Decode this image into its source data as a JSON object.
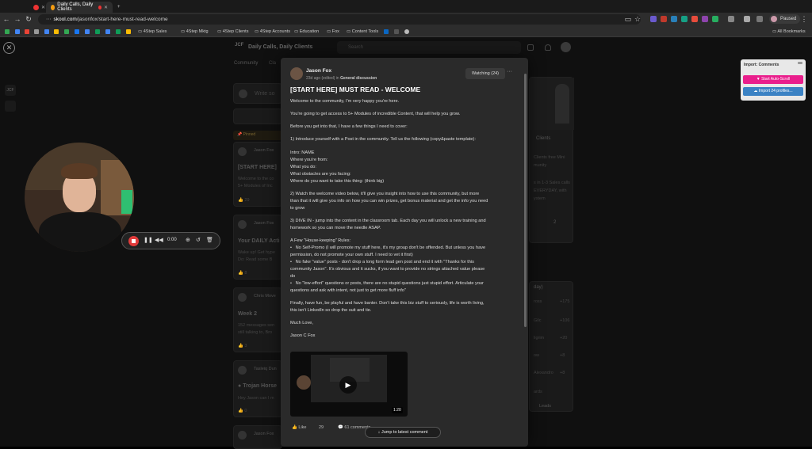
{
  "browser": {
    "tabs": [
      {
        "label": ""
      },
      {
        "label": "Daily Calls, Daily Clients"
      }
    ],
    "url_host": "skool.com",
    "url_path": "/jasonfox/start-here-must-read-welcome",
    "profile_label": "Paused",
    "all_bookmarks": "All Bookmarks",
    "bookmarks": [
      "4Step Sales",
      "4Step Mktg",
      "4Step Clients",
      "4Step Accounts",
      "Education",
      "Fox",
      "Content Tools"
    ]
  },
  "community": {
    "logo": "JCF",
    "name": "Daily Calls, Daily Clients",
    "search_placeholder": "Search",
    "nav_community": "Community",
    "nav_classroom": "Cla",
    "write_placeholder": "Write so",
    "pinned": "Pinned",
    "feed": [
      {
        "author": "Jason Fox",
        "title": "[START HERE]",
        "excerpt1": "Welcome to the co",
        "excerpt2": "5+ Modules of Inc",
        "likes": "29"
      },
      {
        "author": "Jason Fox",
        "title": "Your DAILY Acti",
        "excerpt1": "Wake up! Get hype",
        "excerpt2": "Do: Read some B",
        "likes": "8"
      },
      {
        "author": "Chris Move",
        "title": "Week 2",
        "excerpt1": "152 messages sen",
        "excerpt2": "still talking to, Bro",
        "likes": "3"
      },
      {
        "author": "Tasleiq Dun",
        "title": "Trojan Horse",
        "excerpt1": "Hey Jason can I m",
        "excerpt2": "",
        "likes": "0"
      },
      {
        "author": "Jason Fox",
        "title": "",
        "excerpt1": "",
        "excerpt2": "",
        "likes": ""
      }
    ],
    "sidebar_title": "Clients",
    "sidebar_lines": [
      "Clients free Mini",
      "munity",
      "s in 1-3 Sales calls",
      "EVERYDAY, with",
      "ystem"
    ],
    "leaderboard_title": "day)",
    "leaderboard": [
      {
        "name": "ross",
        "pts": "+175"
      },
      {
        "name": "Gilc",
        "pts": "+106"
      },
      {
        "name": "ligrim",
        "pts": "+20"
      },
      {
        "name": "ow",
        "pts": "+8"
      },
      {
        "name": "Alexandro",
        "pts": "+8"
      }
    ],
    "leaderboard_footer": "ards",
    "leaderboard_link": "Leads"
  },
  "post": {
    "author": "Jason Fox",
    "meta": "23d ago (edited) in",
    "category": "General discussion",
    "watching": "Watching (24)",
    "more": "···",
    "title": "[START HERE] MUST READ - WELCOME",
    "lines": [
      "Welcome to the community, I'm very happy you're here.",
      "You're going to get access to 5+ Modules of incredible Content, that will help you grow.",
      "Before you get into that, I have a few things I need to cover:",
      "1) Introduce yourself with a Post in the community. Tell us the following (copy&paste template):",
      "Intro: NAME",
      "Where you're from:",
      "What you do:",
      "What obstacles are you facing:",
      "Where do you want to take this thing: (think big)",
      "2) Watch the welcome video below, it'll give you insight into how to use this community, but more",
      "than that it will give you info on how you can win prizes, get bonus material and get the info you need",
      "to grow",
      "3) DIVE IN - jump into the content in the classroom tab. Each day you will unlock a new training and",
      "homework so you can move the needle ASAP.",
      "A Few \"House-keeping\" Rules:",
      "No Self-Promo (I will promote my stuff here, it's my group don't be offended. But unless you have",
      "permission, do not promote your own stuff. I need to vet it first)",
      "No fake \"value\" posts - don't drop a long form lead gen post and end it with \"Thanks for this",
      "community Jason\". It's obvious and it sucks, if you want to provide no strings attached value please",
      "do",
      "No \"low-effort\" questions or posts, there are no stupid questions just stupid effort. Articulate your",
      "questions and ask with intent, not just to get more fluff info\"",
      "Finally, have fun, be playful and have banter. Don't take this biz stuff to seriously, life is worth living,",
      "this isn't LinkedIn so drop the suit and tie.",
      "Much Love,",
      "Jason C Fox"
    ],
    "video_duration": "1:20",
    "like_label": "Like",
    "like_count": "29",
    "comments_label": "61 comments",
    "jump_label": "Jump to latest comment"
  },
  "recorder": {
    "time": "0:00"
  },
  "extension": {
    "title": "Import: Comments",
    "btn_primary": "Start Auto-Scroll",
    "btn_secondary": "Import 24 profiles..."
  },
  "colors": {
    "primary_button": "#e91e8c",
    "secondary_button": "#3b82c4",
    "pinned_badge": "#f5b041",
    "record_red": "#e23b3b"
  }
}
